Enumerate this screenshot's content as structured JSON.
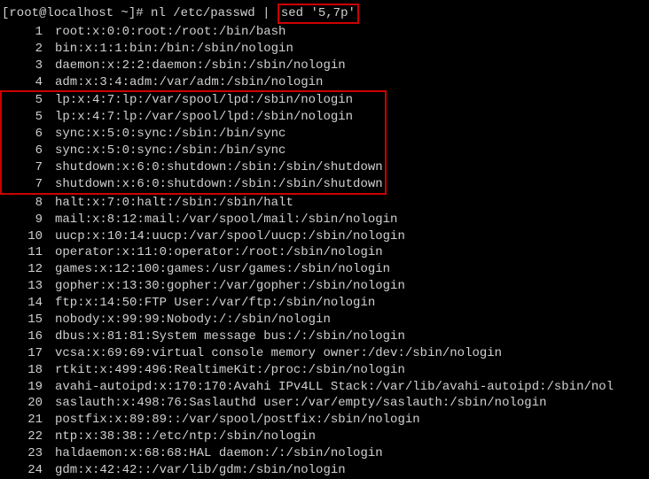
{
  "prompt": {
    "user_host": "[root@localhost ~]#",
    "cmd_prefix": " nl /etc/passwd | ",
    "cmd_highlight": "sed '5,7p'"
  },
  "lines_pre": [
    {
      "n": "1",
      "text": "root:x:0:0:root:/root:/bin/bash"
    },
    {
      "n": "2",
      "text": "bin:x:1:1:bin:/bin:/sbin/nologin"
    },
    {
      "n": "3",
      "text": "daemon:x:2:2:daemon:/sbin:/sbin/nologin"
    },
    {
      "n": "4",
      "text": "adm:x:3:4:adm:/var/adm:/sbin/nologin"
    }
  ],
  "lines_hl": [
    {
      "n": "5",
      "text": "lp:x:4:7:lp:/var/spool/lpd:/sbin/nologin"
    },
    {
      "n": "5",
      "text": "lp:x:4:7:lp:/var/spool/lpd:/sbin/nologin"
    },
    {
      "n": "6",
      "text": "sync:x:5:0:sync:/sbin:/bin/sync"
    },
    {
      "n": "6",
      "text": "sync:x:5:0:sync:/sbin:/bin/sync"
    },
    {
      "n": "7",
      "text": "shutdown:x:6:0:shutdown:/sbin:/sbin/shutdown"
    },
    {
      "n": "7",
      "text": "shutdown:x:6:0:shutdown:/sbin:/sbin/shutdown"
    }
  ],
  "lines_post": [
    {
      "n": "8",
      "text": "halt:x:7:0:halt:/sbin:/sbin/halt"
    },
    {
      "n": "9",
      "text": "mail:x:8:12:mail:/var/spool/mail:/sbin/nologin"
    },
    {
      "n": "10",
      "text": "uucp:x:10:14:uucp:/var/spool/uucp:/sbin/nologin"
    },
    {
      "n": "11",
      "text": "operator:x:11:0:operator:/root:/sbin/nologin"
    },
    {
      "n": "12",
      "text": "games:x:12:100:games:/usr/games:/sbin/nologin"
    },
    {
      "n": "13",
      "text": "gopher:x:13:30:gopher:/var/gopher:/sbin/nologin"
    },
    {
      "n": "14",
      "text": "ftp:x:14:50:FTP User:/var/ftp:/sbin/nologin"
    },
    {
      "n": "15",
      "text": "nobody:x:99:99:Nobody:/:/sbin/nologin"
    },
    {
      "n": "16",
      "text": "dbus:x:81:81:System message bus:/:/sbin/nologin"
    },
    {
      "n": "17",
      "text": "vcsa:x:69:69:virtual console memory owner:/dev:/sbin/nologin"
    },
    {
      "n": "18",
      "text": "rtkit:x:499:496:RealtimeKit:/proc:/sbin/nologin"
    },
    {
      "n": "19",
      "text": "avahi-autoipd:x:170:170:Avahi IPv4LL Stack:/var/lib/avahi-autoipd:/sbin/nol"
    },
    {
      "n": "20",
      "text": "saslauth:x:498:76:Saslauthd user:/var/empty/saslauth:/sbin/nologin"
    },
    {
      "n": "21",
      "text": "postfix:x:89:89::/var/spool/postfix:/sbin/nologin"
    },
    {
      "n": "22",
      "text": "ntp:x:38:38::/etc/ntp:/sbin/nologin"
    },
    {
      "n": "23",
      "text": "haldaemon:x:68:68:HAL daemon:/:/sbin/nologin"
    },
    {
      "n": "24",
      "text": "gdm:x:42:42::/var/lib/gdm:/sbin/nologin"
    }
  ]
}
